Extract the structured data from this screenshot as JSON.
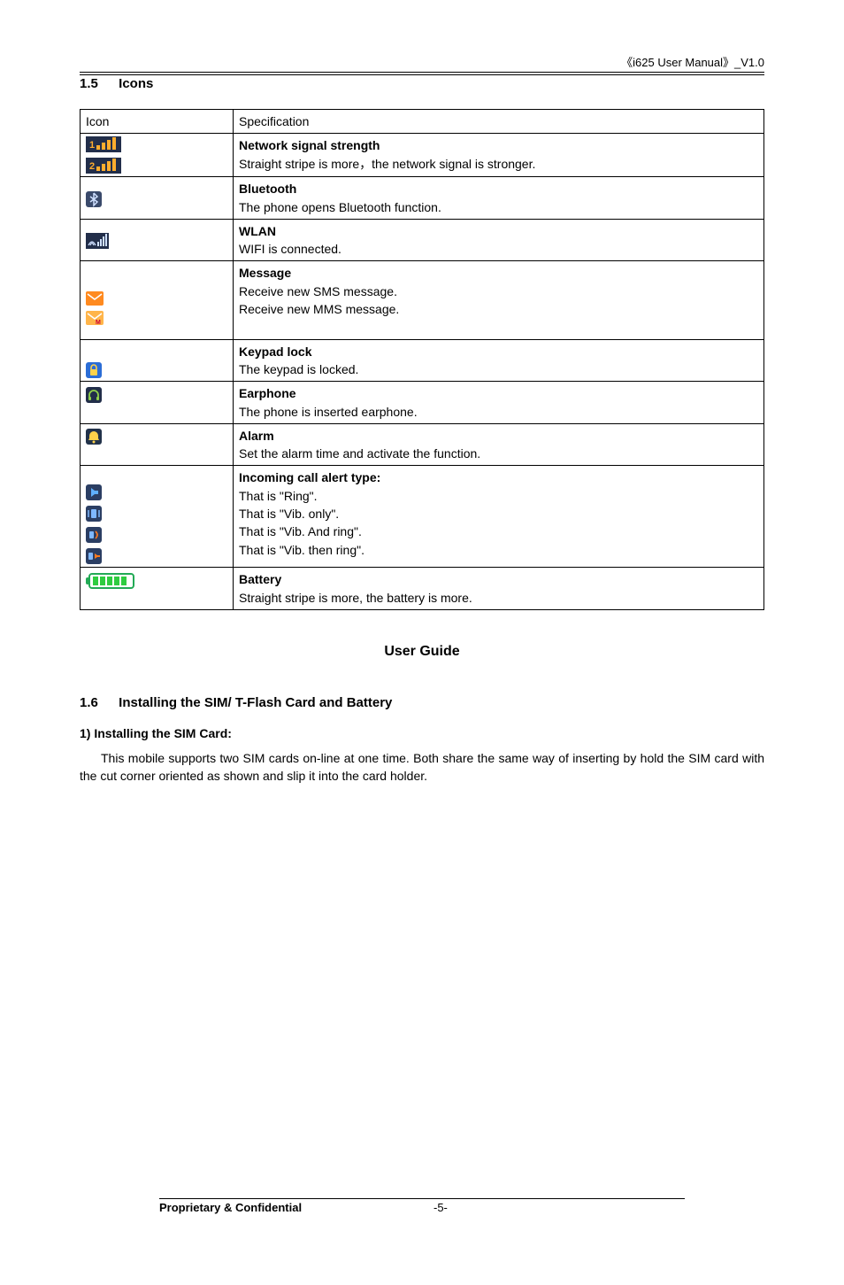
{
  "header": {
    "right": "《i625 User Manual》_V1.0"
  },
  "section15": {
    "num": "1.5",
    "title": "Icons"
  },
  "table": {
    "head": {
      "icon": "Icon",
      "spec": "Specification"
    },
    "rows": [
      {
        "title": "Network signal strength",
        "desc": "Straight stripe is more，the network signal is stronger."
      },
      {
        "title": "Bluetooth",
        "desc": "The phone opens Bluetooth function."
      },
      {
        "title": "WLAN",
        "desc": "WIFI is connected."
      },
      {
        "title": "Message",
        "desc1": "Receive new SMS message.",
        "desc2": "Receive new MMS message."
      },
      {
        "title": "Keypad lock",
        "desc": "The keypad is locked."
      },
      {
        "title": "Earphone",
        "desc": "The phone is inserted earphone."
      },
      {
        "title": "Alarm",
        "desc": "Set the alarm time and activate the function."
      },
      {
        "title": "Incoming call alert type:",
        "l1": "That is \"Ring\".",
        "l2": "That is \"Vib. only\".",
        "l3": "That is \"Vib. And ring\".",
        "l4": "That is \"Vib. then ring\"."
      },
      {
        "title": "Battery",
        "desc": "Straight stripe is more, the battery is more."
      }
    ]
  },
  "userGuide": "User Guide",
  "section16": {
    "num": "1.6",
    "title": "Installing the SIM/ T-Flash Card and Battery"
  },
  "sub1": {
    "num": "1)",
    "title": "Installing the SIM Card:"
  },
  "para1": "This mobile supports two SIM cards on-line at one time. Both share the same way of inserting by hold the SIM card with the cut corner oriented as shown and slip it into the card holder.",
  "footer": {
    "left": "Proprietary & Confidential",
    "page": "-5-"
  }
}
